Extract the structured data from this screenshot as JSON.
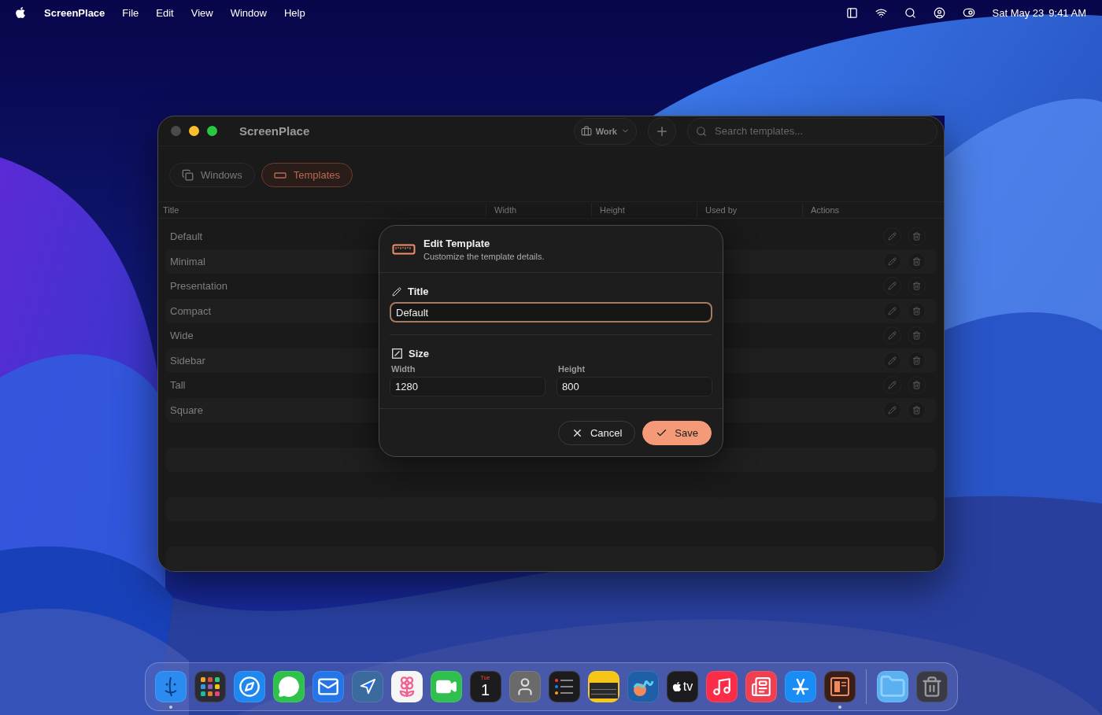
{
  "menu_bar": {
    "app": "ScreenPlace",
    "menus": [
      "File",
      "Edit",
      "View",
      "Window",
      "Help"
    ],
    "date": "Sat May 23",
    "time": "9:41 AM"
  },
  "window": {
    "title": "ScreenPlace",
    "workspace": "Work",
    "search": {
      "placeholder": "Search templates..."
    },
    "tabs": [
      {
        "label": "Windows",
        "kind": "windows",
        "selected": false
      },
      {
        "label": "Templates",
        "kind": "templates",
        "selected": true
      }
    ],
    "table": {
      "columns": [
        "Title",
        "Width",
        "Height",
        "Used by",
        "Actions"
      ],
      "rows": [
        {
          "title": "Default"
        },
        {
          "title": "Minimal"
        },
        {
          "title": "Presentation"
        },
        {
          "title": "Compact"
        },
        {
          "title": "Wide"
        },
        {
          "title": "Sidebar"
        },
        {
          "title": "Tall"
        },
        {
          "title": "Square"
        }
      ]
    }
  },
  "dialog": {
    "title": "Edit Template",
    "subtitle": "Customize the template details.",
    "title_section": {
      "label": "Title",
      "value": "Default"
    },
    "size_section": {
      "label": "Size",
      "width_label": "Width",
      "width_value": "1280",
      "height_label": "Height",
      "height_value": "800"
    },
    "buttons": [
      {
        "label": "Cancel",
        "kind": "cancel"
      },
      {
        "label": "Save",
        "kind": "save"
      }
    ]
  },
  "dock": [
    {
      "kind": "finder",
      "running": true
    },
    {
      "kind": "launchpad",
      "running": false
    },
    {
      "kind": "safari",
      "running": false
    },
    {
      "kind": "messages",
      "running": false
    },
    {
      "kind": "mail",
      "running": false
    },
    {
      "kind": "maps",
      "running": false
    },
    {
      "kind": "photos",
      "running": false
    },
    {
      "kind": "facetime",
      "running": false
    },
    {
      "kind": "calendar",
      "running": false,
      "day": "Tue",
      "date": "1"
    },
    {
      "kind": "contacts",
      "running": false
    },
    {
      "kind": "reminders",
      "running": false
    },
    {
      "kind": "notes",
      "running": false
    },
    {
      "kind": "freeform",
      "running": false
    },
    {
      "kind": "tv",
      "running": false,
      "label": "tv"
    },
    {
      "kind": "music",
      "running": false
    },
    {
      "kind": "news",
      "running": false
    },
    {
      "kind": "appstore",
      "running": false
    },
    {
      "kind": "screenplace",
      "running": true
    },
    {
      "kind": "separator"
    },
    {
      "kind": "folder",
      "running": false
    },
    {
      "kind": "trash",
      "running": false
    }
  ]
}
